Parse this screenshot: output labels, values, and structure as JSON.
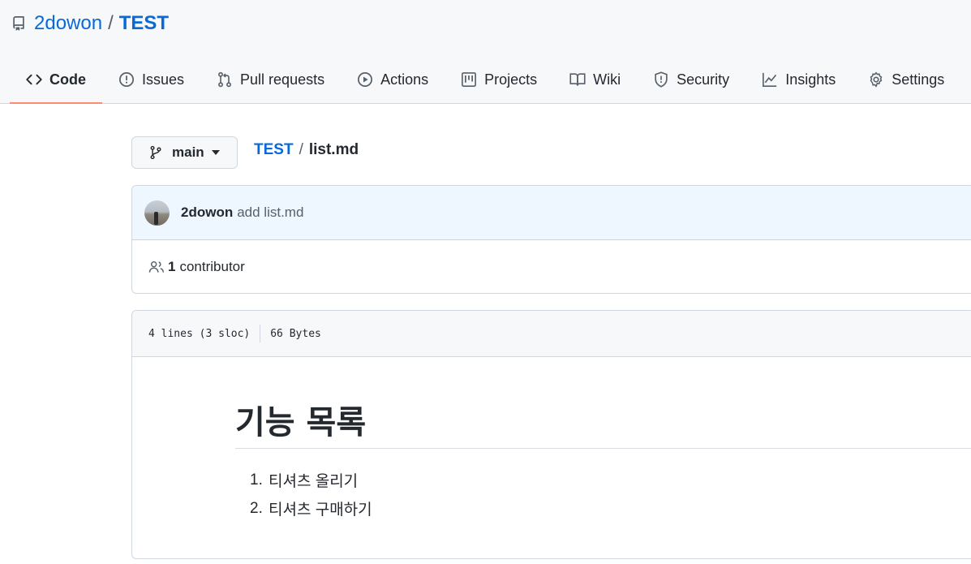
{
  "repo": {
    "owner": "2dowon",
    "separator": "/",
    "name": "TEST"
  },
  "tabs": [
    {
      "label": "Code",
      "icon": "code-icon",
      "selected": true
    },
    {
      "label": "Issues",
      "icon": "issue-icon"
    },
    {
      "label": "Pull requests",
      "icon": "pull-request-icon"
    },
    {
      "label": "Actions",
      "icon": "play-icon"
    },
    {
      "label": "Projects",
      "icon": "project-icon"
    },
    {
      "label": "Wiki",
      "icon": "book-icon"
    },
    {
      "label": "Security",
      "icon": "shield-icon"
    },
    {
      "label": "Insights",
      "icon": "graph-icon"
    },
    {
      "label": "Settings",
      "icon": "gear-icon"
    }
  ],
  "branch": {
    "name": "main",
    "icon": "git-branch-icon"
  },
  "breadcrumb": {
    "repo": "TEST",
    "separator": "/",
    "file": "list.md"
  },
  "commit": {
    "author": "2dowon",
    "message": "add list.md",
    "avatar": "avatar"
  },
  "contributors": {
    "count": "1",
    "label": "contributor",
    "icon": "people-icon"
  },
  "file_info": {
    "lines": "4 lines (3 sloc)",
    "size": "66 Bytes"
  },
  "markdown": {
    "heading": "기능 목록",
    "items": [
      {
        "num": "1.",
        "text": "티셔츠 올리기"
      },
      {
        "num": "2.",
        "text": "티셔츠 구매하기"
      }
    ]
  },
  "colors": {
    "link": "#0969da",
    "selected_tab_underline": "#fd8c73",
    "header_bg": "#f6f8fa",
    "commit_bg": "#eef6ff"
  }
}
